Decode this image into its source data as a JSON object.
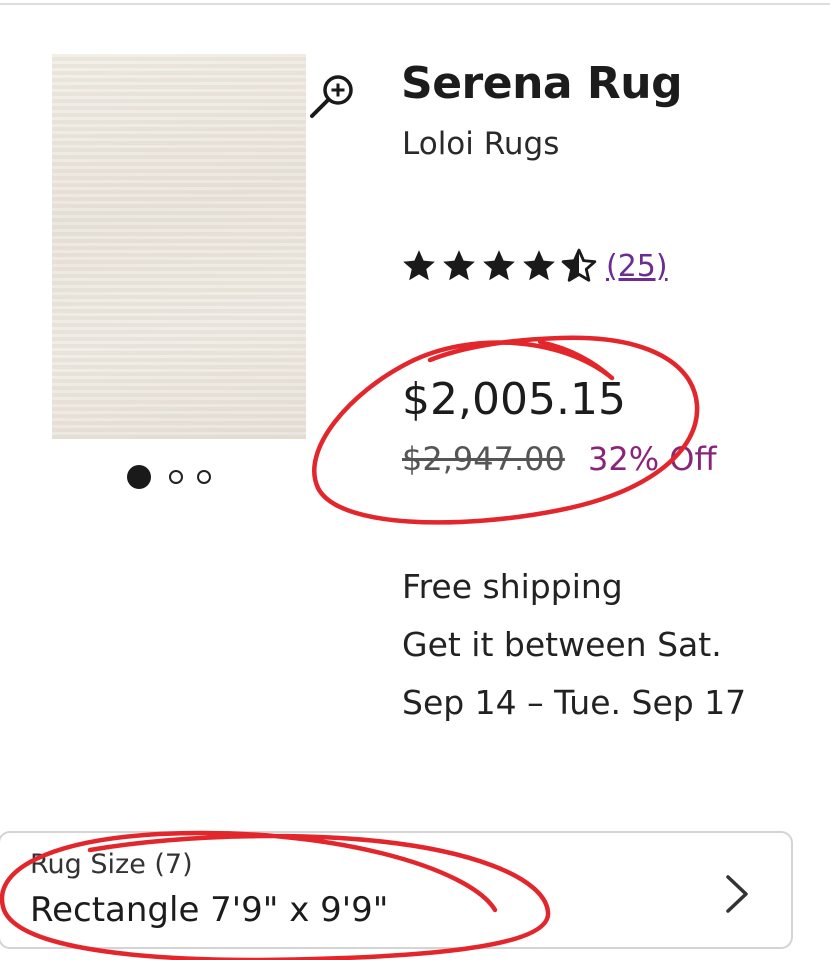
{
  "product": {
    "title": "Serena Rug",
    "brand": "Loloi Rugs",
    "rating": 4.5,
    "rating_max": 5,
    "review_count": "(25)",
    "price": "$2,005.15",
    "was_price": "$2,947.00",
    "discount": "32% Off",
    "image_count": 3,
    "image_index": 1
  },
  "shipping": {
    "line1": "Free shipping",
    "line2": "Get it between Sat.",
    "line3": "Sep 14 – Tue. Sep 17"
  },
  "size_selector": {
    "label": "Rug Size (7)",
    "value": "Rectangle 7'9\" x 9'9\""
  },
  "colors": {
    "text": "#1c1c1c",
    "review_link": "#6b2d8f",
    "discount": "#8b2478",
    "annotation": "#e3262b"
  },
  "icons": {
    "zoom": "zoom-in-icon",
    "stars": "star-icon",
    "chevron": "chevron-right-icon"
  }
}
